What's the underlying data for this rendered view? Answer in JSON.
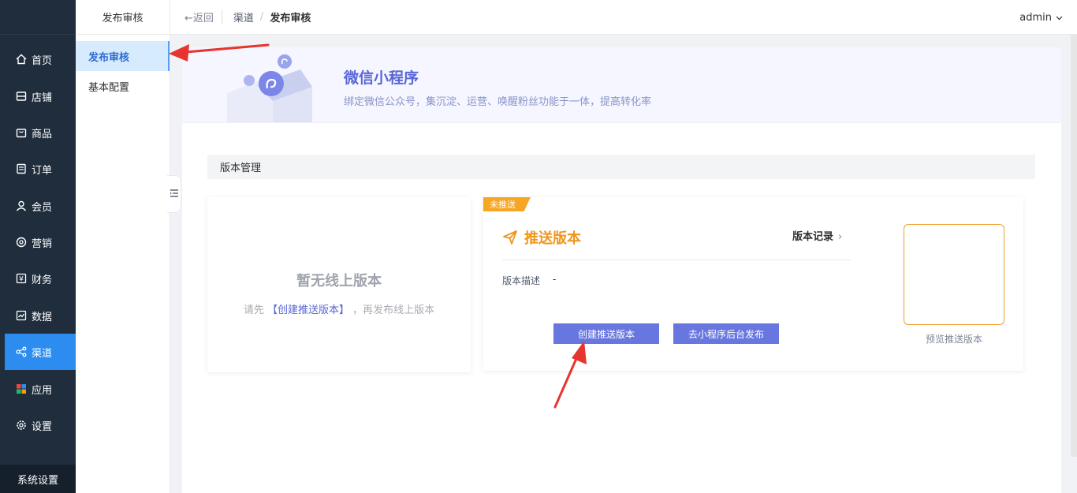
{
  "nav": {
    "items": [
      {
        "label": "首页",
        "icon": "home-icon"
      },
      {
        "label": "店铺",
        "icon": "store-icon"
      },
      {
        "label": "商品",
        "icon": "goods-icon"
      },
      {
        "label": "订单",
        "icon": "order-icon"
      },
      {
        "label": "会员",
        "icon": "user-icon"
      },
      {
        "label": "营销",
        "icon": "marketing-icon"
      },
      {
        "label": "财务",
        "icon": "yuan-icon"
      },
      {
        "label": "数据",
        "icon": "chart-icon"
      },
      {
        "label": "渠道",
        "icon": "channel-icon"
      },
      {
        "label": "应用",
        "icon": "apps-icon"
      },
      {
        "label": "设置",
        "icon": "gear-icon"
      }
    ],
    "active_index": 8,
    "bottom": "系统设置"
  },
  "subnav": {
    "title": "发布审核",
    "items": [
      "发布审核",
      "基本配置"
    ]
  },
  "topbar": {
    "back": "←返回",
    "crumb1": "渠道",
    "crumb_sep": "/",
    "crumb2": "发布审核",
    "user": "admin"
  },
  "banner": {
    "title": "微信小程序",
    "subtitle": "绑定微信公众号，集沉淀、运营、唤醒粉丝功能于一体，提高转化率"
  },
  "section": {
    "title": "版本管理"
  },
  "empty_card": {
    "title": "暂无线上版本",
    "tip_prefix": "请先",
    "tip_link": "【创建推送版本】",
    "tip_suffix": "，再发布线上版本"
  },
  "push_card": {
    "ribbon": "未推送",
    "title": "推送版本",
    "record": "版本记录",
    "desc_label": "版本描述",
    "desc_value": "-",
    "btn_create": "创建推送版本",
    "btn_publish": "去小程序后台发布",
    "preview_label": "预览推送版本"
  },
  "colors": {
    "nav_bg": "#1f2d3d",
    "active_nav": "#2d8cf0",
    "accent": "#6877e0",
    "orange": "#f0961c",
    "annotation_arrow": "#e8342f"
  }
}
